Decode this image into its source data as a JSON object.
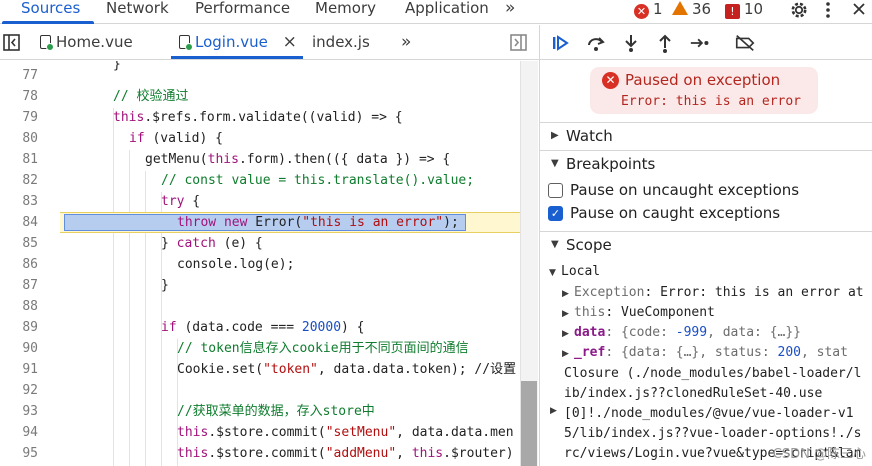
{
  "top_tabs": {
    "sources": "Sources",
    "network": "Network",
    "performance": "Performance",
    "memory": "Memory",
    "application": "Application",
    "more": "»"
  },
  "badges": {
    "errors": "1",
    "warnings": "36",
    "issues": "10"
  },
  "file_tabs": {
    "home": "Home.vue",
    "login": "Login.vue",
    "index": "index.js",
    "close": "×",
    "more": "»"
  },
  "code_lines": {
    "n77": "77",
    "n78": "78",
    "n79": "79",
    "n80": "80",
    "n81": "81",
    "n82": "82",
    "n83": "83",
    "n84": "84",
    "n85": "85",
    "n86": "86",
    "n87": "87",
    "n88": "88",
    "n89": "89",
    "n90": "90",
    "n91": "91",
    "n92": "92",
    "n93": "93",
    "n94": "94",
    "n95": "95",
    "l77": "}",
    "l78": "// 校验通过",
    "l80_if": "if",
    "l80_rest": " (valid) {",
    "l81_a": "getMenu(",
    "l81_this": "this",
    "l81_b": ".form).then(({ data }) => {",
    "l82": "// const value = this.translate().value;",
    "l83": "try",
    "l83_rest": " {",
    "l84_throw": "throw",
    "l84_new": "new",
    "l84_err": " Error(",
    "l84_str": "\"this is an error\"",
    "l84_end": ");",
    "l85_a": "} ",
    "l85_catch": "catch",
    "l85_b": " (e) {",
    "l86": "console.log(e);",
    "l87": "}",
    "l89_if": "if",
    "l89_a": " (data.code === ",
    "l89_num": "20000",
    "l89_b": ") {",
    "l90": "// token信息存入cookie用于不同页面间的通信",
    "l91_a": "Cookie.set(",
    "l91_str": "\"token\"",
    "l91_b": ", data.data.token); //设置",
    "l93": "//获取菜单的数据，存入store中",
    "l94_this": "this",
    "l94_a": ".$store.commit(",
    "l94_str": "\"setMenu\"",
    "l94_b": ", data.data.men",
    "l95_this": "this",
    "l95_a": ".$store.commit(",
    "l95_str": "\"addMenu\"",
    "l95_b": ", ",
    "l95_this2": "this",
    "l95_c": ".$router)",
    "l79_this": "this",
    "l79_rest": ".$refs.form.validate((valid) => {"
  },
  "paused": {
    "title": "Paused on exception",
    "message": "Error: this is an error"
  },
  "sections": {
    "watch": "Watch",
    "breakpoints": "Breakpoints",
    "scope": "Scope"
  },
  "breakpoint_options": {
    "uncaught": "Pause on uncaught exceptions",
    "caught": "Pause on caught exceptions",
    "uncaught_checked": false,
    "caught_checked": true
  },
  "scope": {
    "local": "Local",
    "exception_key": "Exception",
    "exception_val": ": Error: this is an error at",
    "this_key": "this",
    "this_val": ": VueComponent",
    "data_key": "data",
    "data_val_a": ": {code: ",
    "data_val_num": "-999",
    "data_val_b": ", data: {…}}",
    "ref_key": "_ref",
    "ref_val_a": ": {data: {…}, status: ",
    "ref_val_num": "200",
    "ref_val_b": ", stat",
    "closure": "Closure (./node_modules/babel-loader/lib/index.js??clonedRuleSet-40.use[0]!./node_modules/@vue/vue-loader-v15/lib/index.js??vue-loader-options!./src/views/Login.vue?vue&type=script&lang=js&)"
  },
  "watermark": "CSDN @陈三心",
  "colors": {
    "accent": "#1a5fd0",
    "error": "#d93025",
    "warning": "#e37400",
    "issue": "#c5221f"
  }
}
